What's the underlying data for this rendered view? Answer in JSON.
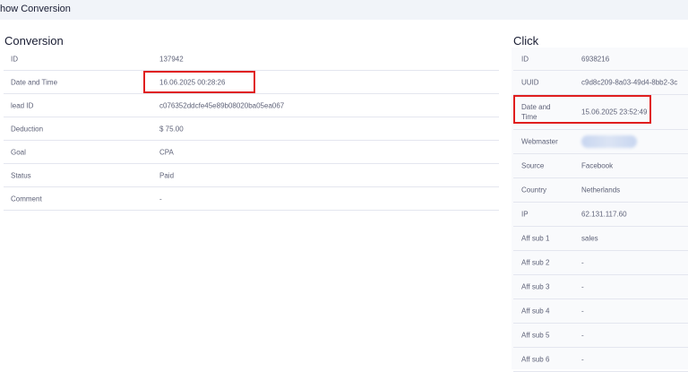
{
  "page": {
    "title": "how Conversion"
  },
  "conversion": {
    "title": "Conversion",
    "rows": [
      {
        "label": "ID",
        "value": "137942"
      },
      {
        "label": "Date and Time",
        "value": "16.06.2025 00:28:26"
      },
      {
        "label": "lead ID",
        "value": "c076352ddcfe45e89b08020ba05ea067"
      },
      {
        "label": "Deduction",
        "value": "$ 75.00"
      },
      {
        "label": "Goal",
        "value": "CPA"
      },
      {
        "label": "Status",
        "value": "Paid"
      },
      {
        "label": "Comment",
        "value": "-"
      }
    ]
  },
  "click": {
    "title": "Click",
    "rows": [
      {
        "label": "ID",
        "value": "6938216"
      },
      {
        "label": "UUID",
        "value": "c9d8c209-8a03-49d4-8bb2-3c"
      },
      {
        "label": "Date and\nTime",
        "value": "15.06.2025 23:52:49"
      },
      {
        "label": "Webmaster",
        "value": ""
      },
      {
        "label": "Source",
        "value": "Facebook"
      },
      {
        "label": "Country",
        "value": "Netherlands"
      },
      {
        "label": "IP",
        "value": "62.131.117.60"
      },
      {
        "label": "Aff sub 1",
        "value": "sales"
      },
      {
        "label": "Aff sub 2",
        "value": "-"
      },
      {
        "label": "Aff sub 3",
        "value": "-"
      },
      {
        "label": "Aff sub 4",
        "value": "-"
      },
      {
        "label": "Aff sub 5",
        "value": "-"
      },
      {
        "label": "Aff sub 6",
        "value": "-"
      }
    ]
  },
  "colors": {
    "highlight": "#e01e1e",
    "panel": "#f9fafc",
    "topbar": "#f1f4f9"
  }
}
